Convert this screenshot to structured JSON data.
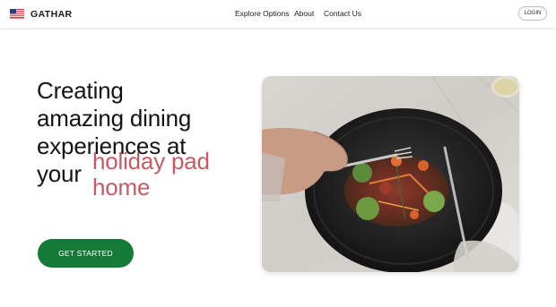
{
  "header": {
    "brand": "GATHAR",
    "nav": [
      "Explore Options",
      "About",
      "Contact Us"
    ],
    "login_label": "LOGIN"
  },
  "hero": {
    "title_lines": [
      "Creating",
      "amazing dining",
      "experiences at",
      "your"
    ],
    "accent_lines": [
      "holiday pad",
      "home"
    ],
    "cta_label": "GET STARTED"
  },
  "colors": {
    "accent": "#c75a65",
    "cta_green": "#137a37",
    "text": "#141414"
  },
  "icons": {
    "flag": "us-flag-icon"
  }
}
